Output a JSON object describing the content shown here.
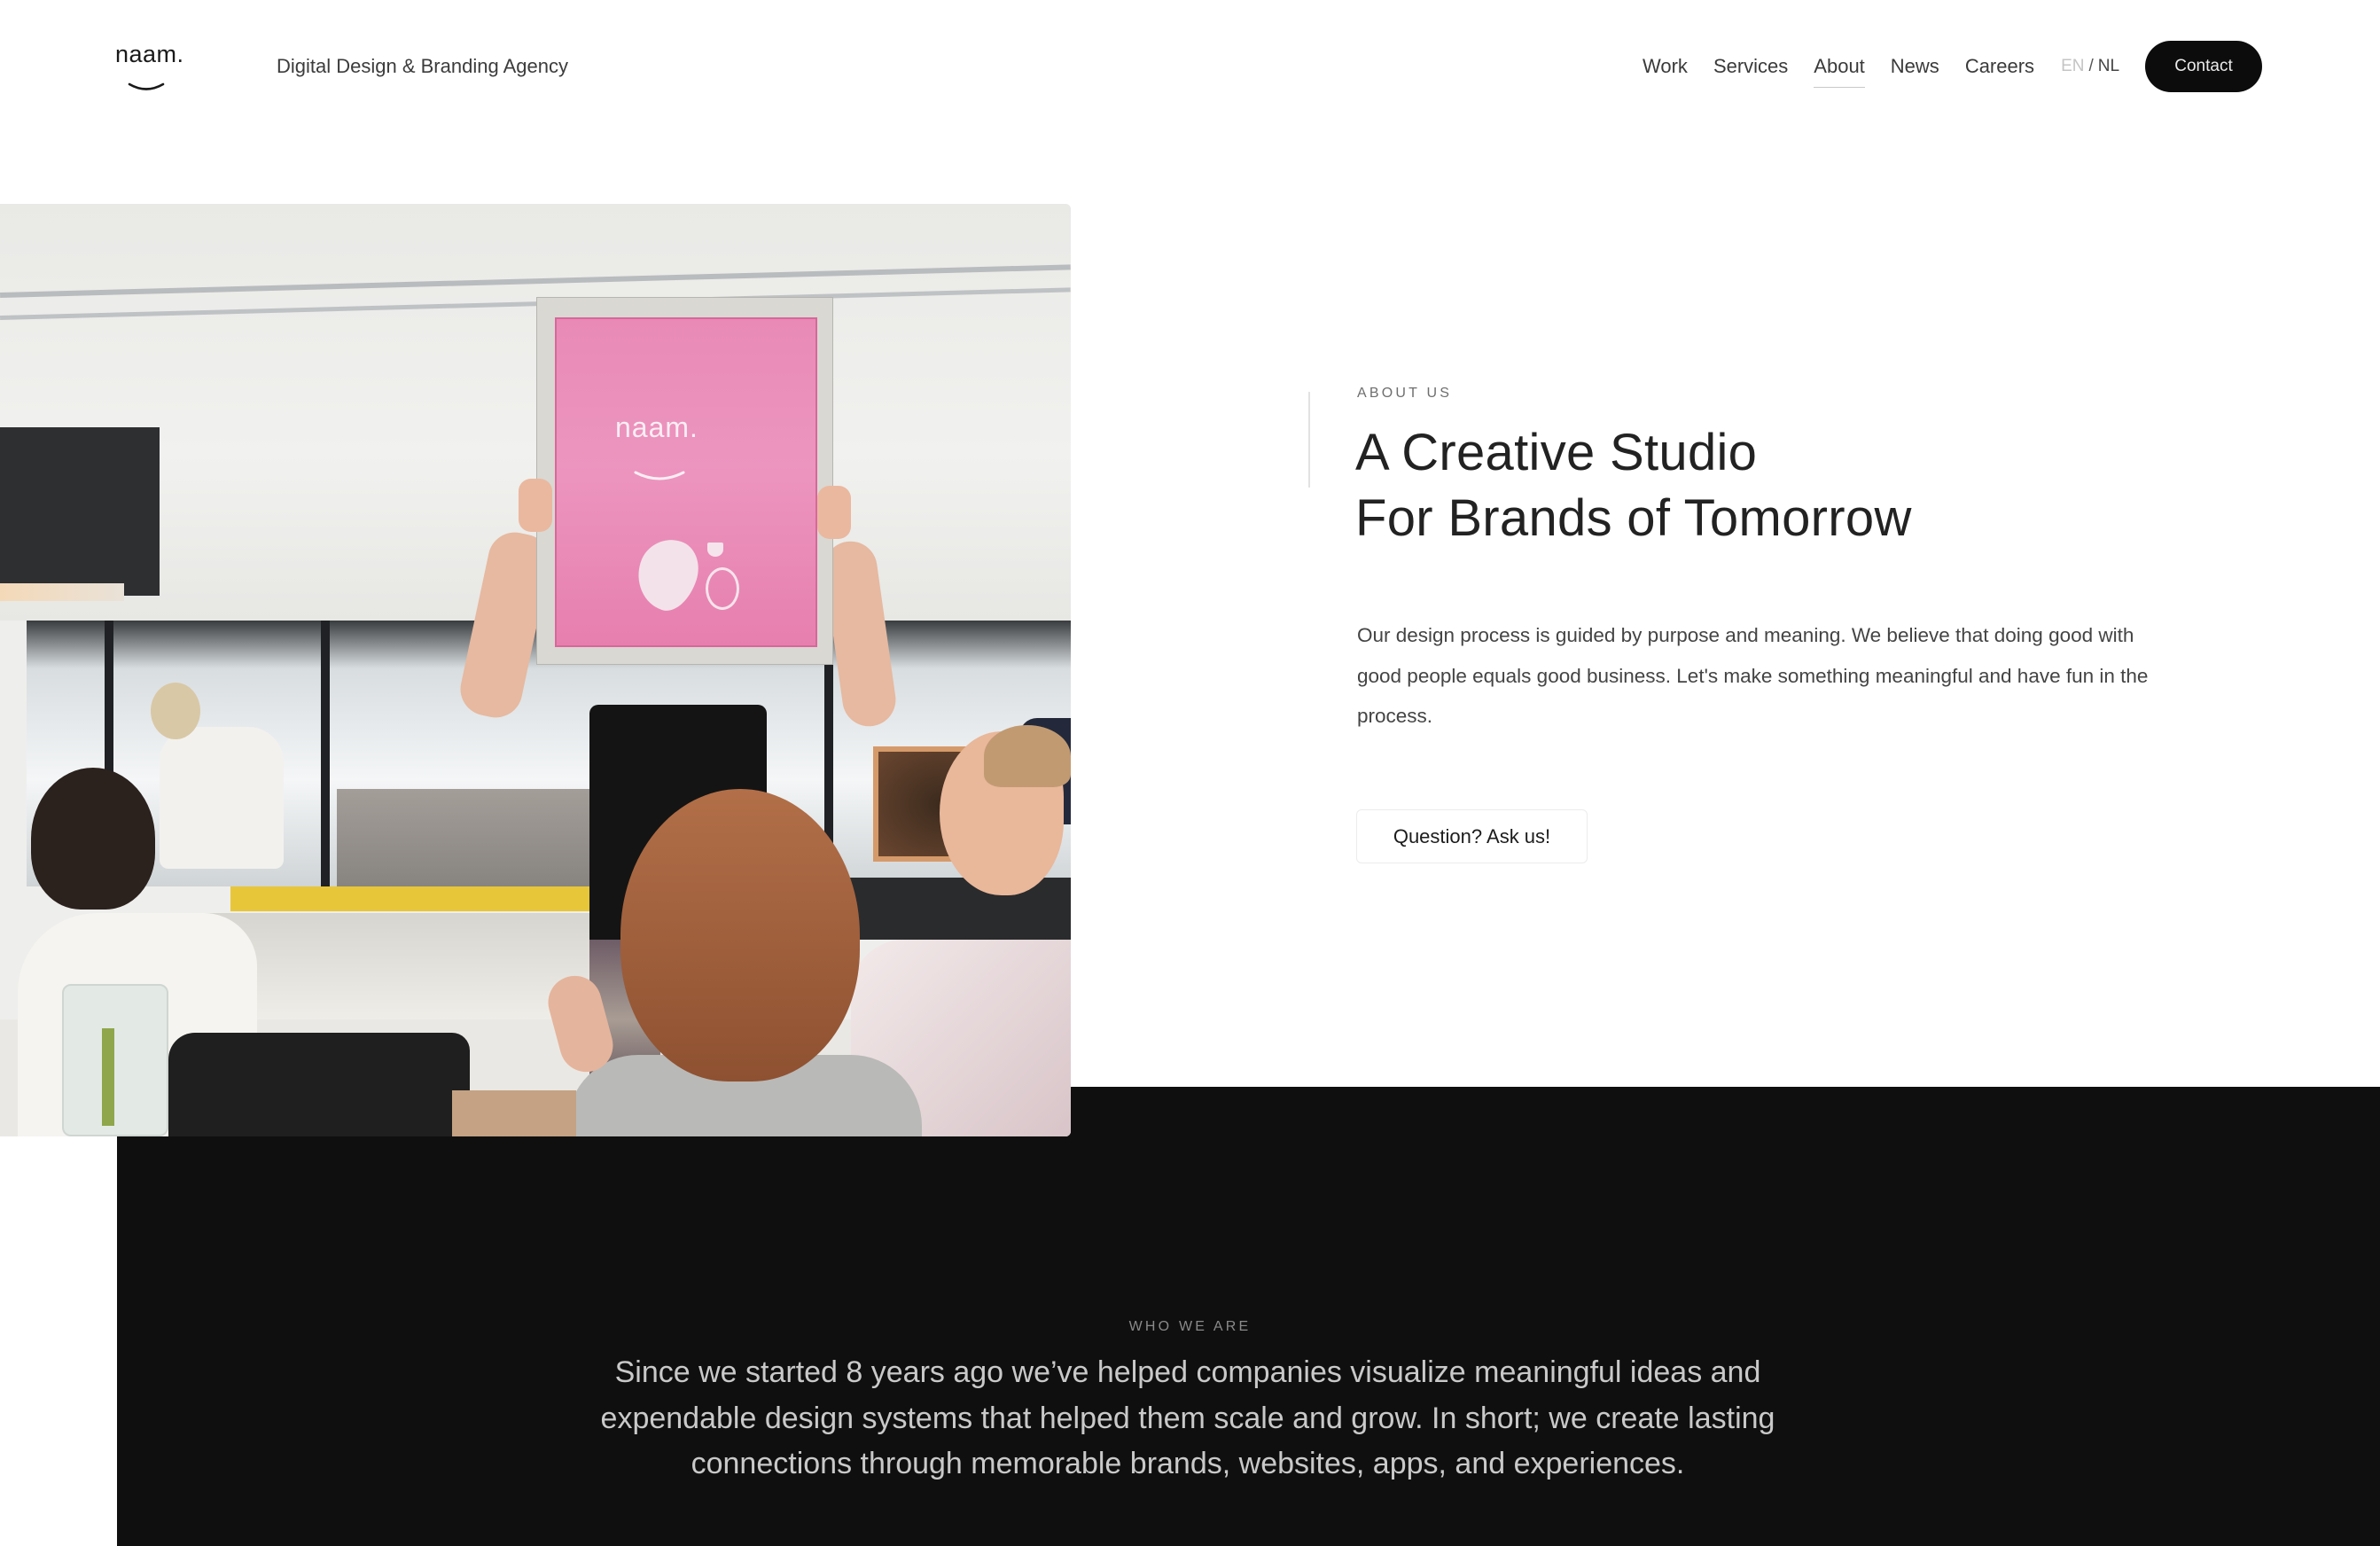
{
  "header": {
    "logo_text": "naam.",
    "tagline": "Digital Design & Branding Agency",
    "nav": [
      {
        "label": "Work",
        "active": false
      },
      {
        "label": "Services",
        "active": false
      },
      {
        "label": "About",
        "active": true
      },
      {
        "label": "News",
        "active": false
      },
      {
        "label": "Careers",
        "active": false
      }
    ],
    "language": {
      "current": "EN",
      "separator": "/",
      "alternate": "NL"
    },
    "contact_label": "Contact"
  },
  "about": {
    "eyebrow": "ABOUT US",
    "headline_lines": [
      "A Creative Studio",
      "For Brands of Tomorrow"
    ],
    "body": "Our design process is guided by purpose and meaning. We believe that doing good with good people equals good business. Let's make something meaningful and have fun in the process.",
    "cta_label": "Question? Ask us!",
    "photo": {
      "description": "Studio team in a screen-printing workshop; person holding up a pink silkscreen frame",
      "frame_text": "naam.",
      "frame_color": "#e98bb6"
    }
  },
  "who_we_are": {
    "eyebrow": "WHO WE ARE",
    "statement": "Since we started 8 years ago we’ve helped companies visualize meaningful ideas and expendable design systems that helped them scale and grow. In short; we create lasting connections through memorable brands, websites, apps, and experiences."
  },
  "colors": {
    "text_dark": "#1a1a1a",
    "button_dark": "#0c0c0c",
    "dark_section": "#0f0f0f",
    "muted": "#8a8a8a"
  }
}
